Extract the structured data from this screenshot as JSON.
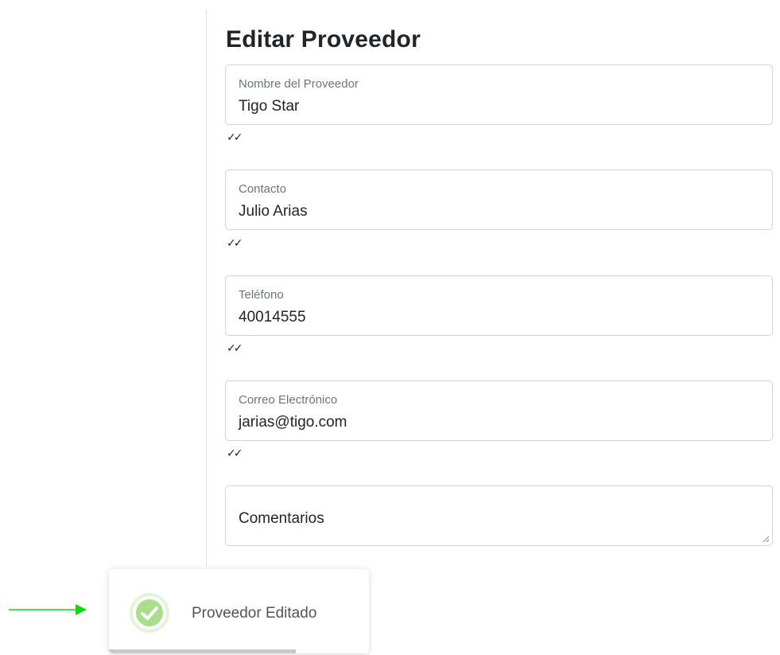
{
  "page": {
    "title": "Editar Proveedor"
  },
  "form": {
    "fields": [
      {
        "label": "Nombre del Proveedor",
        "value": "Tigo Star",
        "validation": "✓✓"
      },
      {
        "label": "Contacto",
        "value": "Julio Arias",
        "validation": "✓✓"
      },
      {
        "label": "Teléfono",
        "value": "40014555",
        "validation": "✓✓"
      },
      {
        "label": "Correo Electrónico",
        "value": "jarias@tigo.com",
        "validation": "✓✓"
      }
    ],
    "comments": {
      "placeholder": "Comentarios"
    }
  },
  "toast": {
    "message": "Proveedor Editado",
    "icon": "success-check-icon",
    "progress_fraction": 0.72
  },
  "colors": {
    "success": "#a5dc86",
    "success_ring": "#e5f3dc",
    "arrow": "#00e000",
    "progress": "#c8c8c8"
  }
}
